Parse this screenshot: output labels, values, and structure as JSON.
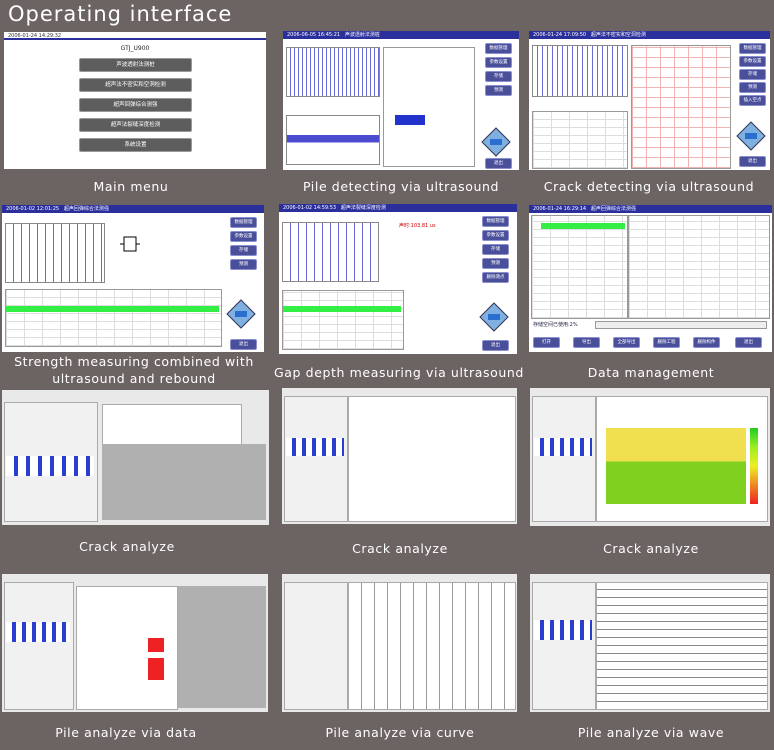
{
  "title": "Operating interface",
  "tiles": [
    {
      "caption": "Main menu"
    },
    {
      "caption": "Pile detecting via ultrasound"
    },
    {
      "caption": "Crack detecting via ultrasound"
    },
    {
      "caption": "Strength measuring combined with ultrasound and rebound"
    },
    {
      "caption": "Gap depth measuring via ultrasound"
    },
    {
      "caption": "Data management"
    },
    {
      "caption": "Crack analyze"
    },
    {
      "caption": "Crack analyze"
    },
    {
      "caption": "Crack analyze"
    },
    {
      "caption": "Pile analyze via data"
    },
    {
      "caption": "Pile analyze via curve"
    },
    {
      "caption": "Pile analyze via wave"
    }
  ],
  "main_menu": {
    "datetime": "2006-01-24 14:29:32",
    "device": "GTJ_U900",
    "items": [
      "声波透射法测桩",
      "超声法不密实和空洞检测",
      "超声回弹综合测强",
      "超声法裂缝深度检测",
      "系统设置"
    ]
  },
  "pile_screen": {
    "datetime": "2006-06-05 16:45:21",
    "title": "声波透射法测桩",
    "buttons": [
      "数据管理",
      "参数设置",
      "存储",
      "预测",
      "退出"
    ]
  },
  "crack_screen": {
    "datetime": "2006-01-24 17:09:50",
    "title": "超声法不密实和空洞检测",
    "buttons": [
      "数据管理",
      "参数设置",
      "存储",
      "预测",
      "插入空点",
      "退出"
    ]
  },
  "strength_screen": {
    "datetime": "2006-01-02 12:01:25",
    "title": "超声回弹综合法测强",
    "buttons": [
      "数据管理",
      "参数设置",
      "存储",
      "预测",
      "退出"
    ]
  },
  "gap_screen": {
    "datetime": "2006-01-02 14:59:53",
    "title": "超声法裂缝深度检测",
    "readout": "声时:103.81 us",
    "buttons": [
      "数据管理",
      "参数设置",
      "存储",
      "预测",
      "删除测点",
      "退出"
    ]
  },
  "data_screen": {
    "datetime": "2006-01-24 16:29:14",
    "title": "超声回弹综合法测强",
    "storage": "存储空间已使用:2%",
    "buttons": [
      "打开",
      "导出",
      "全部导出",
      "删除工程",
      "删除构件",
      "退出"
    ]
  },
  "colors": {
    "background": "#6c6462",
    "header": "#2a2f9c",
    "highlight": "#33ee44"
  }
}
